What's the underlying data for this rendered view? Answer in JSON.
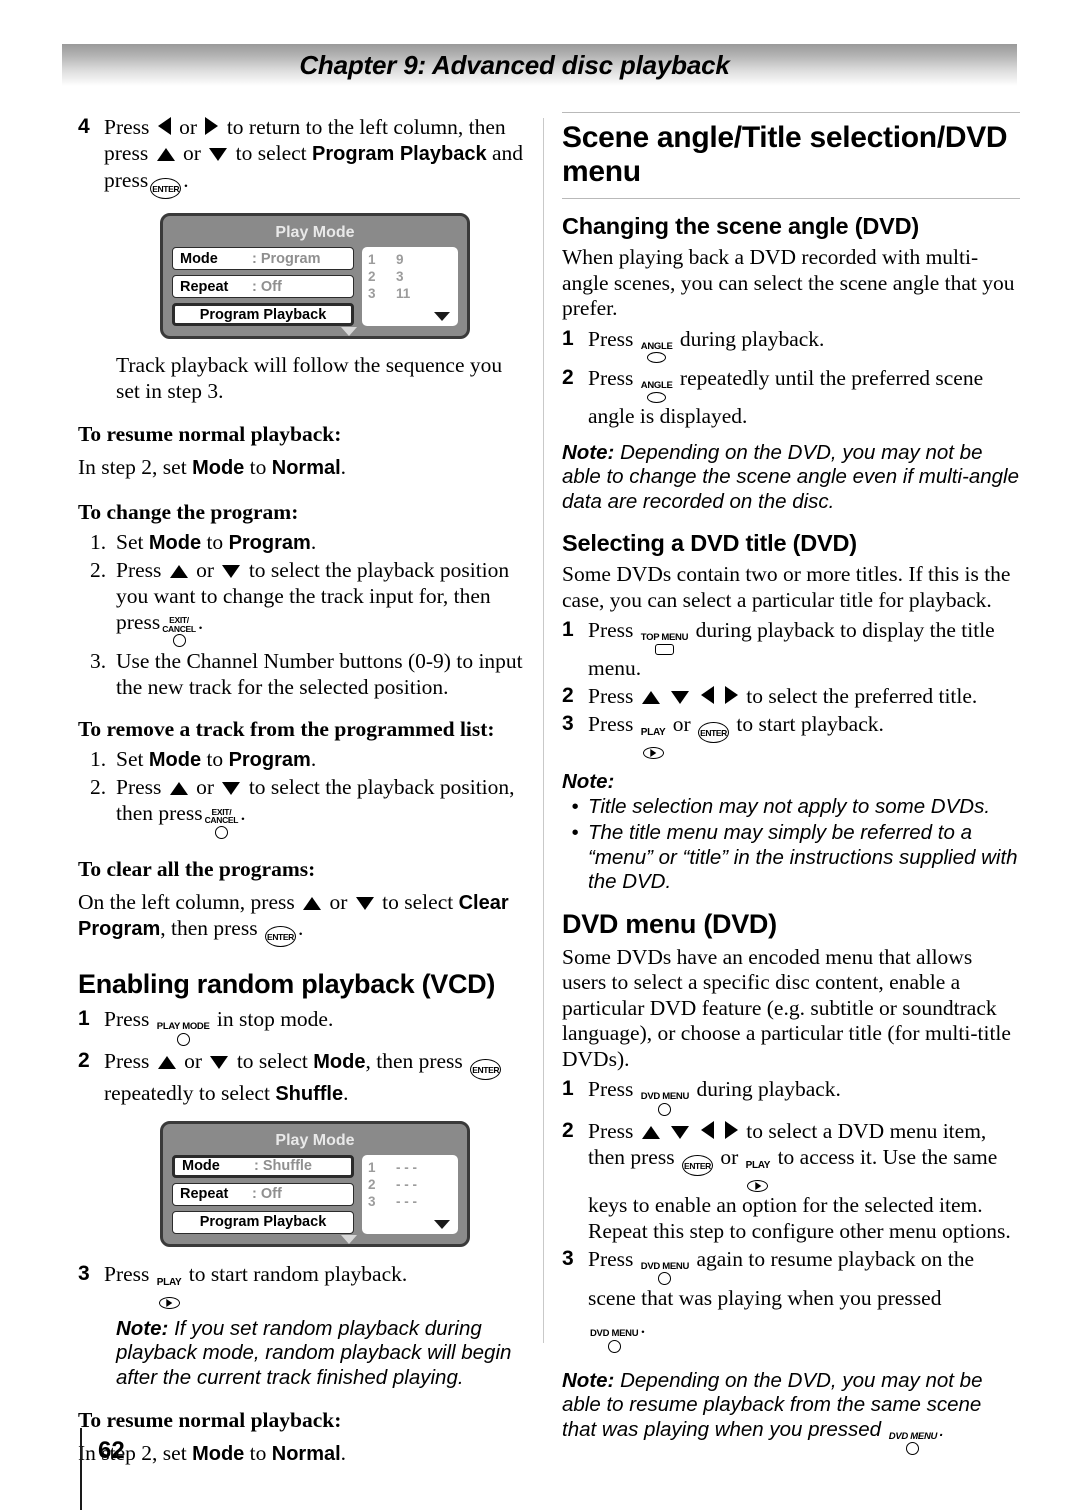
{
  "header": {
    "chapter": "Chapter 9: Advanced disc playback"
  },
  "footer": {
    "page_number": "62"
  },
  "left_column": {
    "step4": {
      "num": "4",
      "line1_a": "Press",
      "line1_b": "or",
      "line1_c": "to return to the left column, then",
      "line2_a": "press",
      "line2_b": "or",
      "line2_c": "to select",
      "line2_bold": "Program Playback",
      "line3_a": "and press",
      "line3_b": "."
    },
    "dialog1": {
      "title": "Play Mode",
      "rows": [
        {
          "label": "Mode",
          "value": ": Program"
        },
        {
          "label": "Repeat",
          "value": ": Off"
        }
      ],
      "action": "Program Playback",
      "selected_row": "Program Playback",
      "tracks": [
        {
          "pos": "1",
          "track": "9"
        },
        {
          "pos": "2",
          "track": "3"
        },
        {
          "pos": "3",
          "track": "11"
        }
      ]
    },
    "after_dialog": "Track playback will follow the sequence you set in step 3.",
    "resume_heading_1": "To resume normal playback:",
    "resume_body_1_a": "In step 2, set",
    "resume_body_1_mode": "Mode",
    "resume_body_1_to": "to",
    "resume_body_1_normal": "Normal",
    "resume_body_1_end": ".",
    "change_heading": "To change the program:",
    "change_items": {
      "i1_num": "1.",
      "i1_a": "Set",
      "i1_mode": "Mode",
      "i1_to": "to",
      "i1_program": "Program",
      "i1_end": ".",
      "i2_num": "2.",
      "i2_a": "Press",
      "i2_or": "or",
      "i2_b": "to select the playback position you want to change the track input for, then press",
      "i2_end": ".",
      "i3_num": "3.",
      "i3_text": "Use the Channel Number buttons (0-9) to input the new track for the selected position."
    },
    "remove_heading": "To remove a track from the programmed list:",
    "remove_items": {
      "i1_num": "1.",
      "i1_a": "Set",
      "i1_mode": "Mode",
      "i1_to": "to",
      "i1_program": "Program",
      "i1_end": ".",
      "i2_num": "2.",
      "i2_a": "Press",
      "i2_or": "or",
      "i2_b": "to select the playback position, then press",
      "i2_end": "."
    },
    "clear_heading": "To clear all the programs:",
    "clear_body_a": "On the left column, press",
    "clear_body_or": "or",
    "clear_body_b": "to select",
    "clear_body_bold": "Clear Program",
    "clear_body_c": ", then press",
    "clear_body_end": ".",
    "random_heading": "Enabling random playback (VCD)",
    "random_step1": {
      "num": "1",
      "a": "Press",
      "key": "PLAY MODE",
      "b": "in stop mode."
    },
    "random_step2": {
      "num": "2",
      "a": "Press",
      "or": "or",
      "b": "to select",
      "mode": "Mode",
      "c": ", then press",
      "d": "repeatedly to select",
      "shuffle": "Shuffle",
      "end": "."
    },
    "dialog2": {
      "title": "Play Mode",
      "rows": [
        {
          "label": "Mode",
          "value": ": Shuffle"
        },
        {
          "label": "Repeat",
          "value": ": Off"
        }
      ],
      "action": "Program Playback",
      "selected_row": "Mode",
      "tracks": [
        {
          "pos": "1",
          "track": "- - -"
        },
        {
          "pos": "2",
          "track": "- - -"
        },
        {
          "pos": "3",
          "track": "- - -"
        }
      ]
    },
    "random_step3": {
      "num": "3",
      "a": "Press",
      "b": "to start random playback."
    },
    "random_note": {
      "label": "Note:",
      "text": "If you set random playback during playback mode, random playback will begin after the current track finished playing."
    },
    "resume_heading_2": "To resume normal playback:",
    "resume_body_2_a": "In step 2, set",
    "resume_body_2_mode": "Mode",
    "resume_body_2_to": "to",
    "resume_body_2_normal": "Normal",
    "resume_body_2_end": "."
  },
  "right_column": {
    "section_title": "Scene angle/Title selection/DVD menu",
    "scene_angle": {
      "heading": "Changing the scene angle (DVD)",
      "body": "When playing back a DVD recorded with multi-angle scenes, you can select the scene angle that you prefer.",
      "step1": {
        "num": "1",
        "a": "Press",
        "key": "ANGLE",
        "b": "during playback."
      },
      "step2": {
        "num": "2",
        "a": "Press",
        "key": "ANGLE",
        "b": "repeatedly until the preferred scene angle is displayed."
      },
      "note": {
        "label": "Note:",
        "text": "Depending on the DVD, you may not be able to change the scene angle even if multi-angle data are recorded on the disc."
      }
    },
    "dvd_title": {
      "heading": "Selecting a DVD title (DVD)",
      "body": "Some DVDs contain two or more titles. If this is the case, you can select a particular title for playback.",
      "step1": {
        "num": "1",
        "a": "Press",
        "key": "TOP MENU",
        "b": "during playback to display the title menu."
      },
      "step2": {
        "num": "2",
        "a": "Press",
        "b": "to select the preferred title."
      },
      "step3": {
        "num": "3",
        "a": "Press",
        "or": "or",
        "b": "to start playback."
      },
      "note_label": "Note:",
      "note_bullets": [
        "Title selection may not apply to some DVDs.",
        "The title menu may simply be referred to a “menu” or “title” in the instructions supplied with the DVD."
      ]
    },
    "dvd_menu": {
      "heading": "DVD menu (DVD)",
      "body": "Some DVDs have an encoded menu that allows users to select a specific disc content, enable a particular DVD feature (e.g. subtitle or soundtrack language), or choose a particular title (for multi-title DVDs).",
      "step1": {
        "num": "1",
        "a": "Press",
        "key": "DVD MENU",
        "b": "during playback."
      },
      "step2": {
        "num": "2",
        "a": "Press",
        "b": "to select a DVD menu item, then press",
        "or": "or",
        "c": "to access it. Use the same keys to enable an option for the selected item.",
        "d": "Repeat this step to configure other menu options."
      },
      "step3": {
        "num": "3",
        "a": "Press",
        "key": "DVD MENU",
        "b": "again to resume playback on the scene that was playing when you pressed",
        "end": "."
      },
      "note": {
        "label": "Note:",
        "text_a": "Depending on the DVD, you may not be able to resume playback from the same scene that was playing when you pressed",
        "key": "DVD MENU",
        "text_b": "."
      }
    }
  },
  "icons": {
    "arrow_up": "arrow-up-icon",
    "arrow_down": "arrow-down-icon",
    "arrow_left": "arrow-left-icon",
    "arrow_right": "arrow-right-icon",
    "enter_key": "enter-button-icon",
    "play_key": "play-button-icon",
    "exit_cancel_key": "exit-cancel-button-icon",
    "play_mode_key": "play-mode-button-icon",
    "angle_key": "angle-button-icon",
    "top_menu_key": "top-menu-button-icon",
    "dvd_menu_key": "dvd-menu-button-icon"
  },
  "key_captions": {
    "enter": "ENTER",
    "play": "PLAY",
    "exit_line1": "EXIT/",
    "exit_line2": "CANCEL",
    "play_mode": "PLAY MODE",
    "angle": "ANGLE",
    "top_menu": "TOP MENU",
    "dvd_menu": "DVD MENU"
  },
  "colors": {
    "dialog_bg": "#8a8a8a",
    "dialog_border": "#3a3a3a",
    "dialog_value_text": "#8f8f8f",
    "header_gradient_start": "#9a9a9a",
    "header_gradient_end": "#ffffff"
  }
}
